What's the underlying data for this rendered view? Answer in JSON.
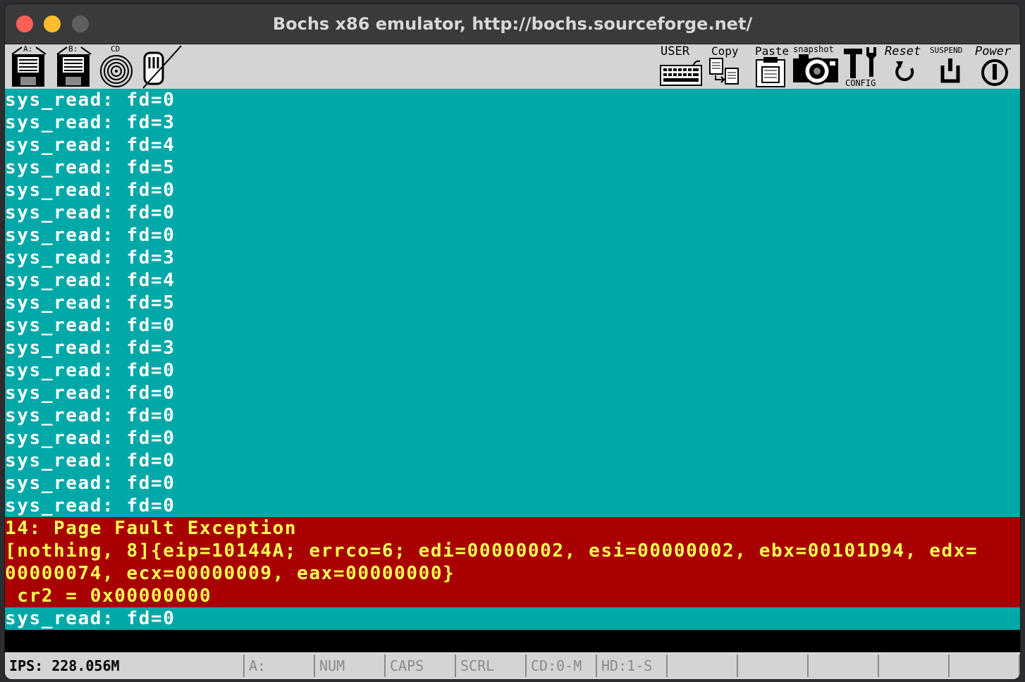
{
  "window": {
    "title": "Bochs x86 emulator, http://bochs.sourceforge.net/"
  },
  "toolbar": {
    "floppy_a_label": "A:",
    "floppy_b_label": "B:",
    "cdrom_label": "CD",
    "user_label": "USER",
    "copy_label": "Copy",
    "paste_label": "Paste",
    "snapshot_label": "snapshot",
    "config_label": "CONFIG",
    "reset_label": "Reset",
    "suspend_label": "SUSPEND",
    "power_label": "Power"
  },
  "console": {
    "lines": [
      "sys_read: fd=0",
      "sys_read: fd=3",
      "sys_read: fd=4",
      "sys_read: fd=5",
      "sys_read: fd=0",
      "sys_read: fd=0",
      "sys_read: fd=0",
      "sys_read: fd=3",
      "sys_read: fd=4",
      "sys_read: fd=5",
      "sys_read: fd=0",
      "sys_read: fd=3",
      "sys_read: fd=0",
      "sys_read: fd=0",
      "sys_read: fd=0",
      "sys_read: fd=0",
      "sys_read: fd=0",
      "sys_read: fd=0",
      "sys_read: fd=0"
    ],
    "error": [
      "14: Page Fault Exception",
      "[nothing, 8]{eip=10144A; errco=6; edi=00000002, esi=00000002, ebx=00101D94, edx=",
      "00000074, ecx=00000009, eax=00000000}",
      " cr2 = 0x00000000"
    ],
    "last_line": "sys_read: fd=0",
    "colors": {
      "background": "#00a8a8",
      "text": "#ffffff",
      "error_background": "#a80000",
      "error_text": "#ffff54"
    }
  },
  "status": {
    "ips": "IPS: 228.056M",
    "floppy": "A:",
    "num": "NUM",
    "caps": "CAPS",
    "scrl": "SCRL",
    "cd": "CD:0-M",
    "hd": "HD:1-S"
  }
}
